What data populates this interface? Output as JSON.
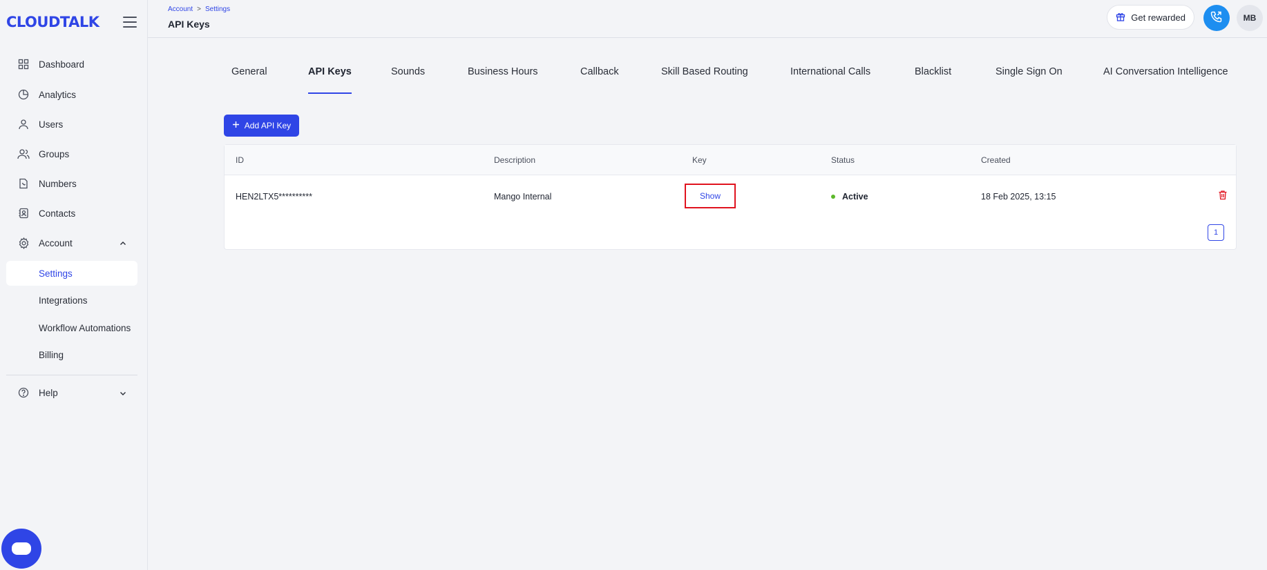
{
  "app": {
    "logo": "CLOUDTALK"
  },
  "sidebar": {
    "items": [
      {
        "label": "Dashboard"
      },
      {
        "label": "Analytics"
      },
      {
        "label": "Users"
      },
      {
        "label": "Groups"
      },
      {
        "label": "Numbers"
      },
      {
        "label": "Contacts"
      },
      {
        "label": "Account"
      }
    ],
    "subitems": [
      {
        "label": "Settings",
        "active": true
      },
      {
        "label": "Integrations"
      },
      {
        "label": "Workflow Automations"
      },
      {
        "label": "Billing"
      }
    ],
    "help": {
      "label": "Help"
    }
  },
  "header": {
    "breadcrumb": [
      "Account",
      "Settings"
    ],
    "breadcrumb_sep": ">",
    "title": "API Keys",
    "rewards_label": "Get rewarded",
    "avatar_initials": "MB"
  },
  "tabs": [
    {
      "label": "General"
    },
    {
      "label": "API Keys",
      "active": true
    },
    {
      "label": "Sounds"
    },
    {
      "label": "Business Hours"
    },
    {
      "label": "Callback"
    },
    {
      "label": "Skill Based Routing"
    },
    {
      "label": "International Calls"
    },
    {
      "label": "Blacklist"
    },
    {
      "label": "Single Sign On"
    },
    {
      "label": "AI Conversation Intelligence"
    }
  ],
  "add_button": {
    "label": "Add API Key"
  },
  "table": {
    "columns": [
      "ID",
      "Description",
      "Key",
      "Status",
      "Created"
    ],
    "rows": [
      {
        "id": "HEN2LTX5**********",
        "description": "Mango Internal",
        "key_action": "Show",
        "status": "Active",
        "created": "18 Feb 2025, 13:15"
      }
    ],
    "pagination": {
      "current_page": "1"
    }
  },
  "colors": {
    "accent": "#2f45e6",
    "danger": "#e0121e",
    "active_status": "#5cb82a",
    "phone": "#1d8ef0"
  }
}
